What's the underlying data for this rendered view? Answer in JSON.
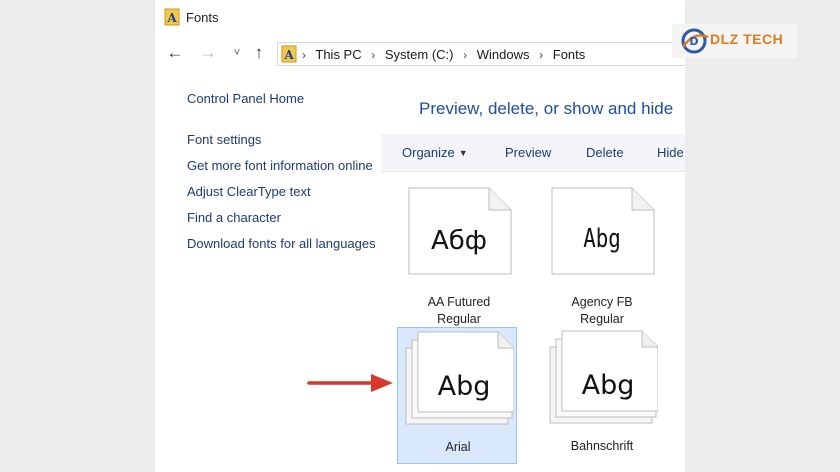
{
  "window": {
    "title": "Fonts"
  },
  "nav": {
    "back": "←",
    "forward": "→",
    "recent": "˅",
    "up": "↑"
  },
  "address": {
    "crumbs": [
      "This PC",
      "System (C:)",
      "Windows",
      "Fonts"
    ],
    "separator": "›"
  },
  "sidebar": {
    "home": "Control Panel Home",
    "links": [
      "Font settings",
      "Get more font information online",
      "Adjust ClearType text",
      "Find a character",
      "Download fonts for all languages"
    ]
  },
  "main": {
    "heading": "Preview, delete, or show and hide",
    "toolbar": {
      "organize": "Organize",
      "preview": "Preview",
      "delete": "Delete",
      "hide": "Hide"
    },
    "fonts": [
      {
        "sample": "Абф",
        "name": "AA Futured Regular",
        "name_line1": "AA Futured",
        "name_line2": "Regular",
        "selected": false,
        "family": false
      },
      {
        "sample": "Abg",
        "name": "Agency FB Regular",
        "name_line1": "Agency FB",
        "name_line2": "Regular",
        "selected": false,
        "family": false
      },
      {
        "sample": "Abg",
        "name": "Arial",
        "name_line1": "Arial",
        "name_line2": "",
        "selected": true,
        "family": true
      },
      {
        "sample": "Abg",
        "name": "Bahnschrift",
        "name_line1": "Bahnschrift",
        "name_line2": "",
        "selected": false,
        "family": true
      }
    ]
  },
  "watermark": {
    "brand": "DLZ TECH",
    "icon": "dlz-tech-logo"
  },
  "colors": {
    "link": "#1e3a78",
    "heading": "#1e4ea0",
    "selection": "#d9e8fb",
    "arrow": "#d9362c"
  }
}
